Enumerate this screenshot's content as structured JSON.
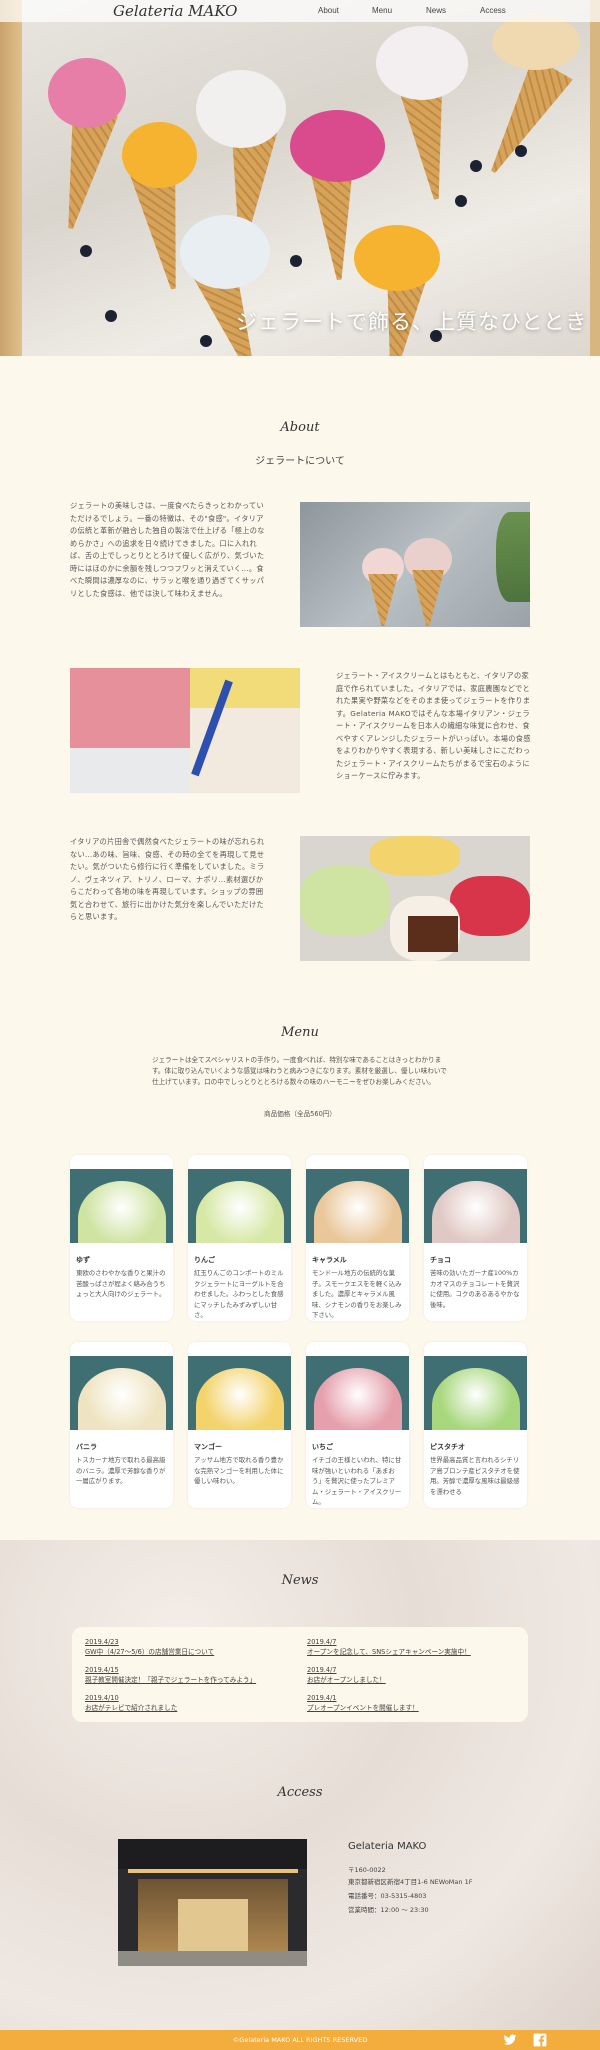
{
  "header": {
    "logo": "Gelateria MAKO",
    "nav": [
      "About",
      "Menu",
      "News",
      "Access"
    ]
  },
  "hero": {
    "title": "ジェラートで飾る、上質なひととき"
  },
  "about": {
    "title": "About",
    "subtitle": "ジェラートについて",
    "blocks": [
      {
        "text": "ジェラートの美味しさは、一度食べたらきっとわかっていただけるでしょう。一番の特徴は、その\"食感\"。イタリアの伝統と革新が融合した独自の製法で仕上げる「極上のなめらかさ」への追求を日々続けてきました。口に入れれば、舌の上でしっとりととろけて優しく広がり、気づいた時にはほのかに余韻を残しつつフワッと消えていく…。食べた瞬間は濃厚なのに、サラッと喉を通り過ぎてくサッパリとした食感は、他では決して味わえません。"
      },
      {
        "text": "ジェラート・アイスクリームとはもともと、イタリアの家庭で作られていました。イタリアでは、家庭農園などでとれた果実や野菜などをそのまま使ってジェラートを作ります。Gelateria MAKOではそんな本場イタリアン・ジェラート・アイスクリームを日本人の繊細な味覚に合わせ、食べやすくアレンジしたジェラートがいっぱい。本場の食感をよりわかりやすく表現する、新しい美味しさにこだわったジェラート・アイスクリームたちがまるで宝石のようにショーケースに佇みます。"
      },
      {
        "text": "イタリアの片田舎で偶然食べたジェラートの味が忘れられない…あの味、旨味、食感、その時の全てを再現して見せたい。気がついたら修行に行く準備をしていました。ミラノ、ヴェネツィア、トリノ、ローマ、ナポリ…素材選びからこだわって各地の味を再現しています。ショップの雰囲気と合わせて、旅行に出かけた気分を楽しんでいただけたらと思います。"
      }
    ]
  },
  "menu": {
    "title": "Menu",
    "intro": "ジェラートは全てスペシャリストの手作り。一度食べれば、特別な味であることはきっとわかります。体に取り込んでいくような感覚は味わうと病みつきになります。素材を厳選し、優しい味わいで仕上げています。口の中でしっとりととろける数々の味のハーモニーをぜひお楽しみください。",
    "price": "商品価格（全品560円）",
    "items": [
      {
        "name": "ゆず",
        "desc": "東欧のさわやかな香りと果汁の苦酸っぱさが程よく絡み合うちょっと大人向けのジェラート。",
        "color": "#cfe4a3"
      },
      {
        "name": "りんご",
        "desc": "紅玉りんごのコンポートのミルクジェラートにヨーグルトを合わせました。ふわっとした食感にマッチしたみずみずしい甘さ。",
        "color": "#d7e8a6"
      },
      {
        "name": "キャラメル",
        "desc": "モンドール地方の伝統的な菓子。スモークエスをを軽く込みました。濃厚とキャラメル風味、シナモンの香りをお楽しみ下さい。",
        "color": "#e9c79a"
      },
      {
        "name": "チョコ",
        "desc": "苦味の効いたガーナ産100%カカオマスのチョコレートを贅沢に使用。コクのあるあるやかな後味。",
        "color": "#e0c9c4"
      },
      {
        "name": "バニラ",
        "desc": "トスカーナ地方で取れる最高級のバニラ。濃厚で芳醇な香りが一層広がります。",
        "color": "#efe4c2"
      },
      {
        "name": "マンゴー",
        "desc": "アッサム地方で取れる香り豊かな完熟マンゴーを利用した体に優しい味わい。",
        "color": "#f3d36c"
      },
      {
        "name": "いちご",
        "desc": "イチゴの王様といわれ、特に甘味が強いといわれる「あまおう」を贅沢に使ったプレミアム・ジェラート・アイスクリーム。",
        "color": "#e5a0ac"
      },
      {
        "name": "ピスタチオ",
        "desc": "世界最高品質と言われるシチリア島ブロンテ産ピスタチオを使用。芳醇で濃厚な風味は最級感を漂わせる",
        "color": "#a9d77e"
      }
    ]
  },
  "news": {
    "title": "News",
    "items": [
      {
        "date": "2019.4/23",
        "text": "GW中（4/27〜5/6）の店舗営業日について"
      },
      {
        "date": "2019.4/15",
        "text": "親子教室開催決定！「親子でジェラートを作ってみよう」"
      },
      {
        "date": "2019.4/10",
        "text": "お店がテレビで紹介されました"
      },
      {
        "date": "2019.4/7",
        "text": "オープンを記念して、SNSシェアキャンペーン実施中！"
      },
      {
        "date": "2019.4/7",
        "text": "お店がオープンしました！"
      },
      {
        "date": "2019.4/1",
        "text": "プレオープンイベントを開催します！"
      }
    ]
  },
  "access": {
    "title": "Access",
    "name": "Gelateria MAKO",
    "postal": "〒160-0022",
    "address": "東京都新宿区新宿4丁目1-6 NEWoMan 1F",
    "phone": "電話番号：03-5315-4803",
    "hours": "営業時間：12:00 〜 23:30"
  },
  "footer": {
    "copyright": "©Gelateria MAKO ALL RIGHTS RESERVED"
  },
  "colors": {
    "background": "#fdf8ec",
    "accent": "#f2ad3d",
    "card": "#ffffff"
  },
  "icons": [
    "twitter-icon",
    "facebook-icon"
  ]
}
